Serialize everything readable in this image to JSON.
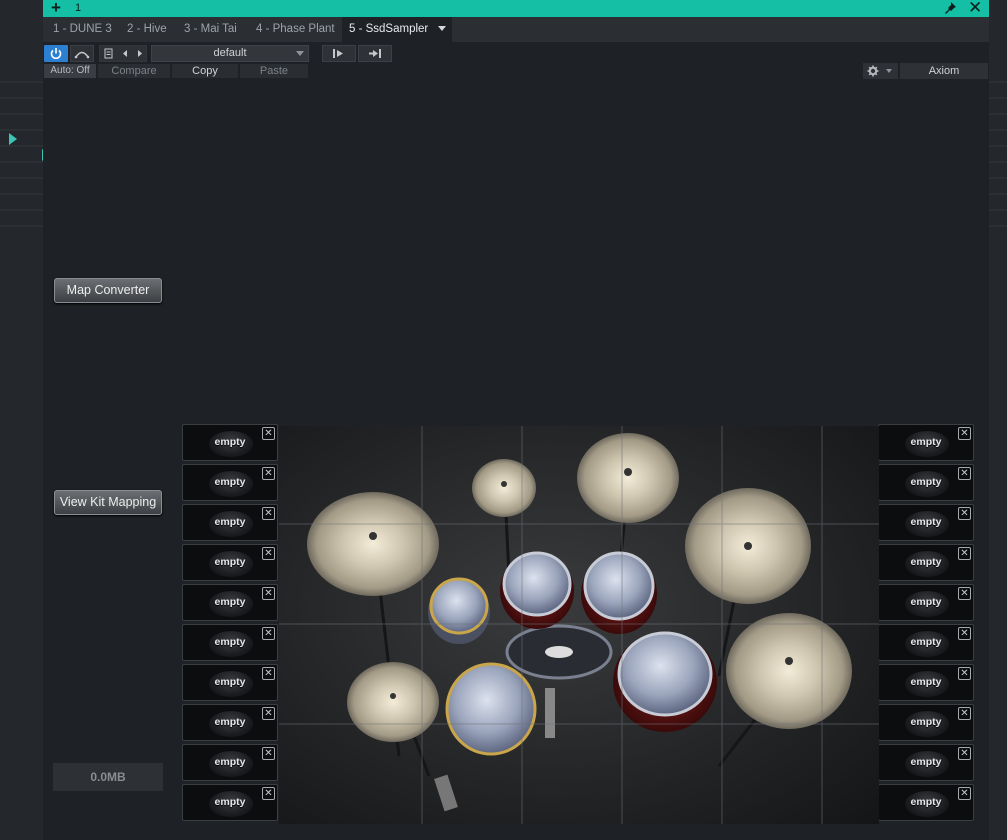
{
  "window": {
    "tab_number": "1",
    "tabs": [
      {
        "label": "1 - DUNE 3"
      },
      {
        "label": "2 - Hive"
      },
      {
        "label": "3 - Mai Tai"
      },
      {
        "label": "4 - Phase Plant"
      },
      {
        "label": "5 - SsdSampler"
      }
    ],
    "active_tab": "5 - SsdSampler"
  },
  "toolbar": {
    "preset": "default",
    "auto": "Auto: Off",
    "compare": "Compare",
    "copy": "Copy",
    "paste": "Paste",
    "device": "Axiom"
  },
  "plugin": {
    "map_converter": "Map Converter",
    "view_kit_mapping": "View Kit Mapping",
    "memory": "0.0MB",
    "left_slots": [
      "empty",
      "empty",
      "empty",
      "empty",
      "empty",
      "empty",
      "empty",
      "empty",
      "empty",
      "empty"
    ],
    "right_slots": [
      "empty",
      "empty",
      "empty",
      "empty",
      "empty",
      "empty",
      "empty",
      "empty",
      "empty",
      "empty"
    ]
  },
  "colors": {
    "accent": "#14bfa6",
    "power": "#2c7fd1",
    "note": "#3ec4b4"
  }
}
